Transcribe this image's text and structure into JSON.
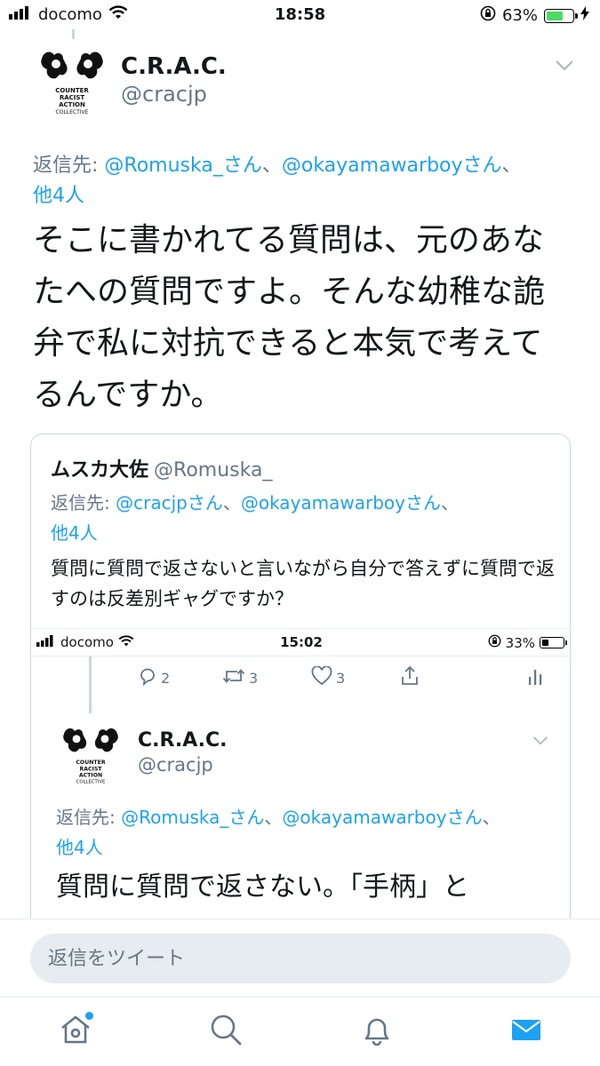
{
  "status_bar": {
    "carrier": "docomo",
    "time": "18:58",
    "battery": "63%",
    "battery_level": 0.63
  },
  "tweet": {
    "name": "C.R.A.C.",
    "handle": "@cracjp",
    "avatar_text": [
      "COUNTER",
      "RACIST",
      "ACTION",
      "COLLECTIVE"
    ],
    "reply_prefix": "返信先: ",
    "reply_mentions": [
      "@Romuska_さん",
      "@okayamawarboyさん"
    ],
    "reply_sep": "、",
    "reply_others": "他4人",
    "text": "そこに書かれてる質問は、元のあなたへの質問ですよ。そんな幼稚な詭弁で私に対抗できると本気で考えてるんですか。"
  },
  "quote": {
    "name": "ムスカ大佐",
    "handle": "@Romuska_",
    "reply_prefix": "返信先: ",
    "reply_mentions": [
      "@cracjpさん",
      "@okayamawarboyさん"
    ],
    "reply_sep": "、",
    "reply_others": "他4人",
    "text": "質問に質問で返さないと言いながら自分で答えずに質問で返すのは反差別ギャグですか？"
  },
  "embed": {
    "status_bar": {
      "carrier": "docomo",
      "time": "15:02",
      "battery": "33%",
      "battery_level": 0.33
    },
    "actions": {
      "replies": "2",
      "retweets": "3",
      "likes": "3"
    },
    "tweet": {
      "name": "C.R.A.C.",
      "handle": "@cracjp",
      "reply_prefix": "返信先: ",
      "reply_mentions": [
        "@Romuska_さん",
        "@okayamawarboyさん"
      ],
      "reply_sep": "、",
      "reply_others": "他4人",
      "text": "質問に質問で返さない。「手柄」と"
    }
  },
  "reply_bar": {
    "placeholder": "返信をツイート"
  },
  "tabbar": {
    "items": [
      "home-icon",
      "search-icon",
      "notifications-icon",
      "messages-icon"
    ]
  },
  "colors": {
    "accent": "#1da1f2",
    "muted": "#657786",
    "text": "#14171a",
    "battery_green": "#4cd964"
  }
}
